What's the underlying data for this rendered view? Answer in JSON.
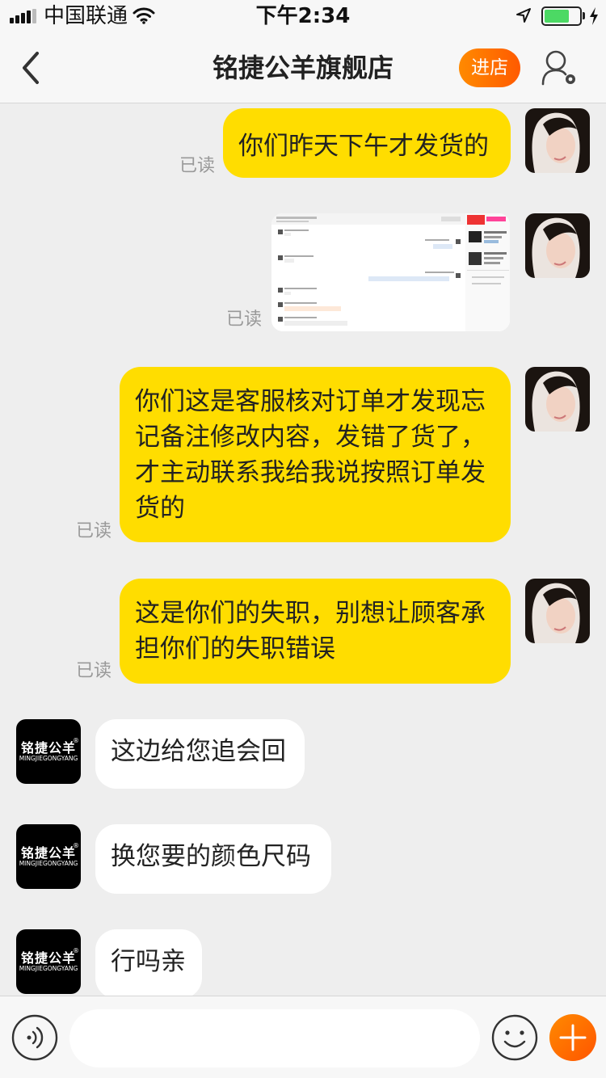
{
  "status_bar": {
    "carrier": "中国联通",
    "time": "下午2:34",
    "battery_level": 0.72
  },
  "nav": {
    "title": "铭捷公羊旗舰店",
    "enter_store": "进店"
  },
  "store_logo": {
    "cn": "铭捷公羊",
    "en": "MINGJIEGONGYANG",
    "mark": "®"
  },
  "messages": [
    {
      "side": "out",
      "type": "text",
      "text": "你们昨天下午才发货的",
      "status": "已读"
    },
    {
      "side": "out",
      "type": "image",
      "status": "已读"
    },
    {
      "side": "out",
      "type": "text",
      "text": "你们这是客服核对订单才发现忘记备注修改内容，发错了货了，才主动联系我给我说按照订单发货的",
      "status": "已读"
    },
    {
      "side": "out",
      "type": "text",
      "text": "这是你们的失职，别想让顾客承担你们的失职错误",
      "status": "已读"
    },
    {
      "side": "in",
      "type": "text",
      "text": "这边给您追会回"
    },
    {
      "side": "in",
      "type": "text",
      "text": "换您要的颜色尺码"
    },
    {
      "side": "in",
      "type": "text",
      "text": "行吗亲"
    }
  ],
  "input": {
    "placeholder": ""
  },
  "colors": {
    "out_bubble": "#ffdd00",
    "in_bubble": "#ffffff",
    "accent": "#ff6a00",
    "background": "#eeeeee"
  }
}
